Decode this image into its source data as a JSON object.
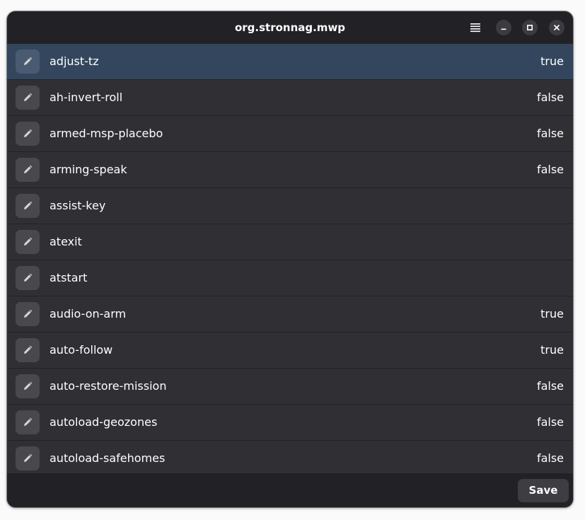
{
  "window": {
    "title": "org.stronnag.mwp"
  },
  "icons": {
    "menu": "hamburger-menu-icon",
    "minimize": "minimize-icon",
    "maximize": "maximize-icon",
    "close": "close-icon",
    "edit": "pencil-icon"
  },
  "colors": {
    "window_bg": "#2e2e32",
    "headerbar_bg": "#222226",
    "row_bg": "#303034",
    "selected_row_bg": "#33465e",
    "text": "#ffffff"
  },
  "settings": [
    {
      "name": "adjust-tz",
      "value": "true",
      "selected": true
    },
    {
      "name": "ah-invert-roll",
      "value": "false"
    },
    {
      "name": "armed-msp-placebo",
      "value": "false"
    },
    {
      "name": "arming-speak",
      "value": "false"
    },
    {
      "name": "assist-key",
      "value": ""
    },
    {
      "name": "atexit",
      "value": ""
    },
    {
      "name": "atstart",
      "value": ""
    },
    {
      "name": "audio-on-arm",
      "value": "true"
    },
    {
      "name": "auto-follow",
      "value": "true"
    },
    {
      "name": "auto-restore-mission",
      "value": "false"
    },
    {
      "name": "autoload-geozones",
      "value": "false"
    },
    {
      "name": "autoload-safehomes",
      "value": "false"
    }
  ],
  "footer": {
    "save_label": "Save"
  }
}
